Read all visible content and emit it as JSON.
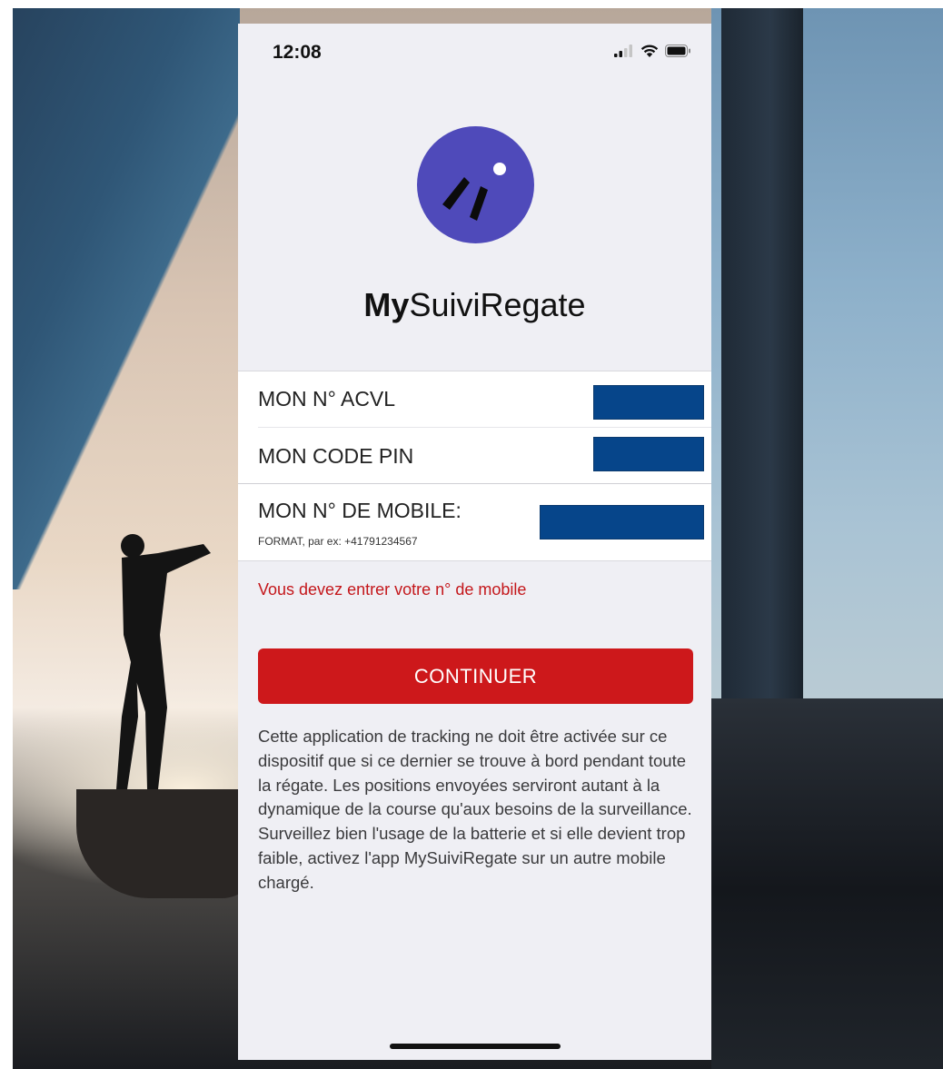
{
  "status_bar": {
    "time": "12:08",
    "icons": [
      "cellular-signal-icon",
      "wifi-icon",
      "battery-icon"
    ]
  },
  "app": {
    "title_bold": "My",
    "title_rest": "SuiviRegate",
    "logo_color": "#4f4aba"
  },
  "form": {
    "acvl_label": "MON N° ACVL",
    "pin_label": "MON CODE PIN",
    "mobile_label": "MON N° DE MOBILE:",
    "mobile_hint": "FORMAT, par ex: +41791234567",
    "field_color": "#06458a"
  },
  "error": {
    "message": "Vous devez entrer votre n° de mobile",
    "color": "#c4171b"
  },
  "continue_button": {
    "label": "CONTINUER",
    "color": "#cd181b"
  },
  "info": {
    "text": "Cette application de tracking ne doit être activée sur ce dispositif que si ce dernier se trouve à bord pendant toute la régate. Les positions envoyées serviront autant à la dynamique de la course qu'aux besoins de la surveillance. Surveillez bien l'usage de la batterie et si elle devient trop faible, activez l'app MySuiviRegate sur un autre mobile chargé."
  }
}
